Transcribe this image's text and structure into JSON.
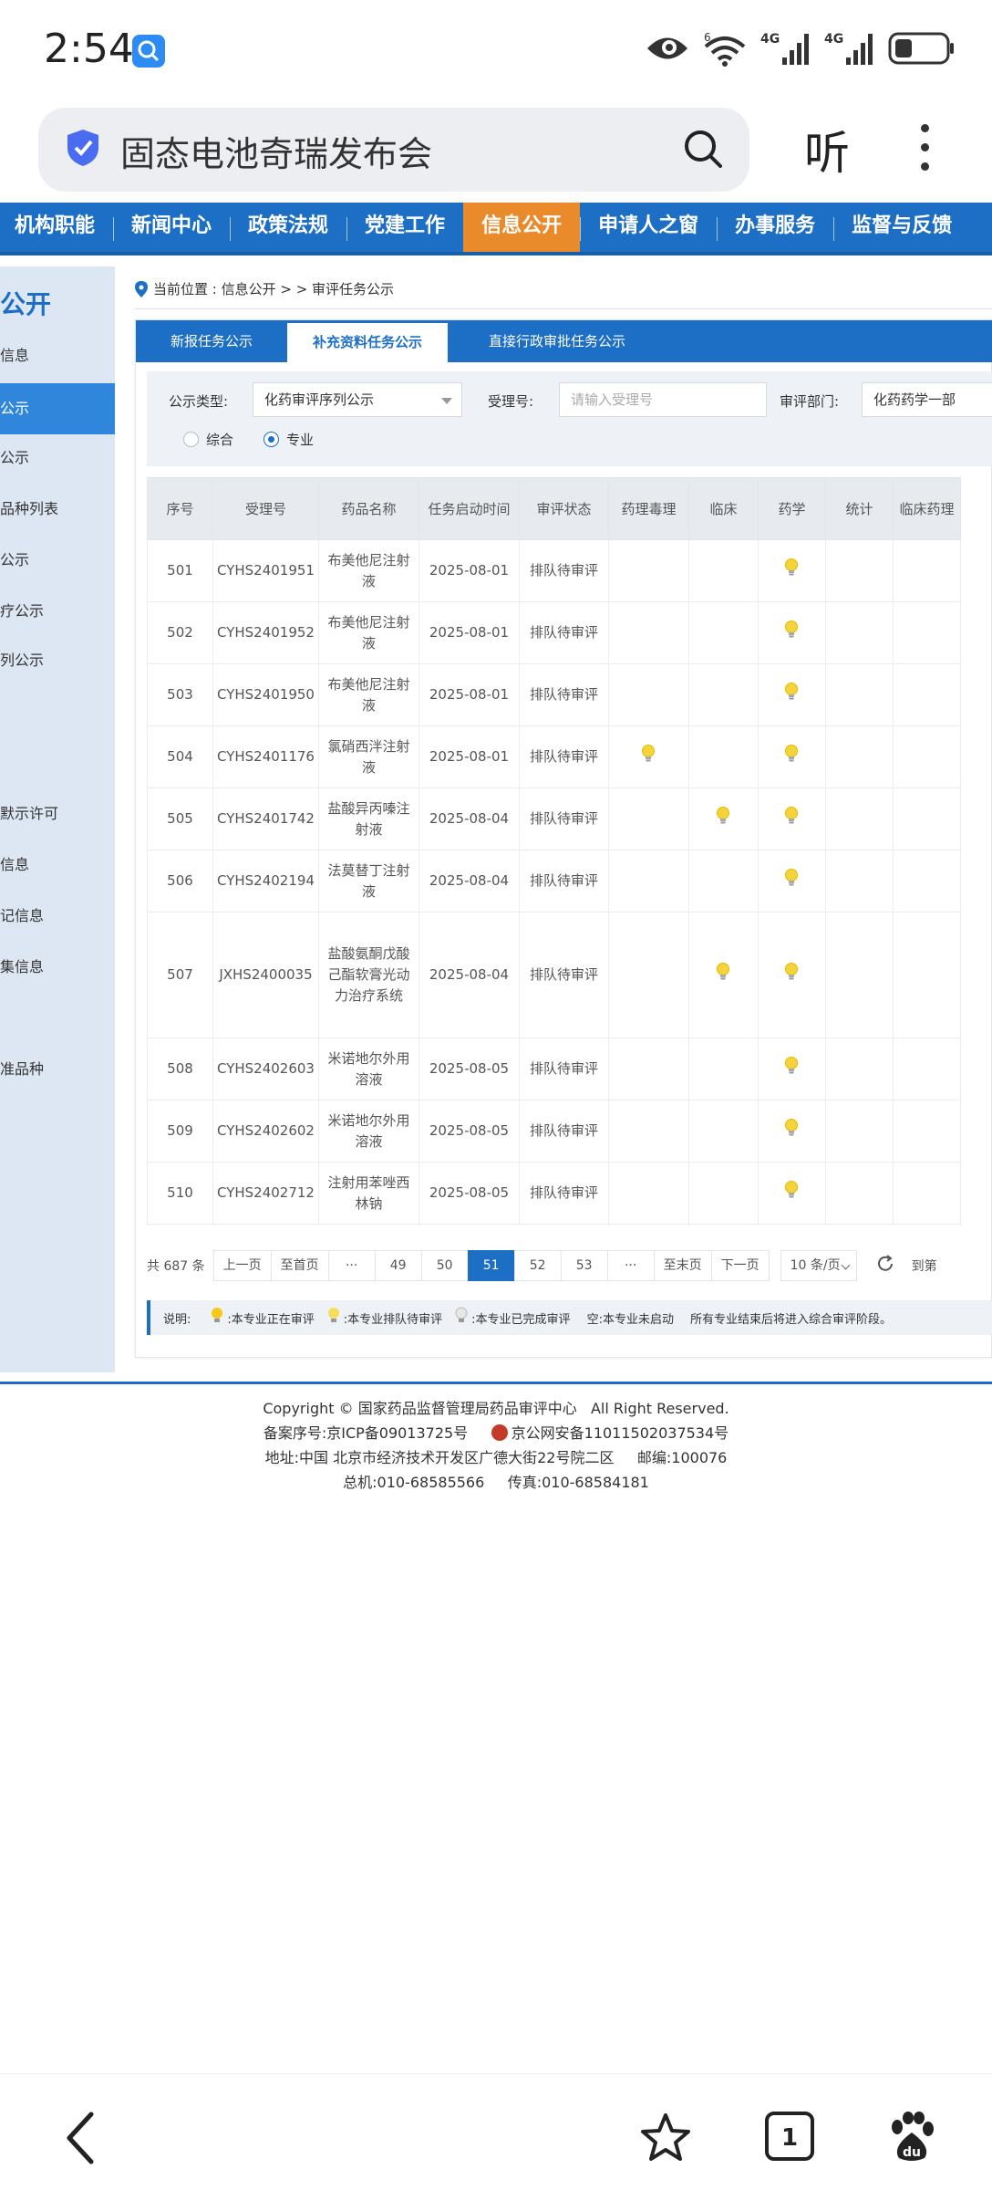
{
  "status_bar": {
    "time": "2:54",
    "icons": [
      "search-app-icon",
      "eye-icon",
      "wifi-6-icon",
      "signal-4g-icon",
      "signal-4g-icon",
      "battery-icon"
    ],
    "wifi_label": "6",
    "net1": "4G",
    "net2": "4G"
  },
  "browser": {
    "search_text": "固态电池奇瑞发布会",
    "listen_label": "听"
  },
  "nav": {
    "items": [
      "机构职能",
      "新闻中心",
      "政策法规",
      "党建工作",
      "信息公开",
      "申请人之窗",
      "办事服务",
      "监督与反馈"
    ],
    "active_index": 4
  },
  "sidebar": {
    "title": "公开",
    "items": [
      "信息",
      "公示",
      "公示",
      "品种列表",
      "公示",
      "疗公示",
      "列公示",
      "默示许可",
      "信息",
      "记信息",
      "集信息",
      "准品种"
    ],
    "active_index": 1
  },
  "breadcrumb": {
    "text": "当前位置 : 信息公开 > > 审评任务公示"
  },
  "tabs": [
    "新报任务公示",
    "补充资料任务公示",
    "直接行政审批任务公示"
  ],
  "tabs_active_index": 1,
  "filters": {
    "type_label": "公示类型:",
    "type_value": "化药审评序列公示",
    "accept_label": "受理号:",
    "accept_placeholder": "请输入受理号",
    "dept_label": "审评部门:",
    "dept_value": "化药药学一部",
    "radio1": "综合",
    "radio2": "专业",
    "radio_selected": "专业"
  },
  "table": {
    "headers": [
      "序号",
      "受理号",
      "药品名称",
      "任务启动时间",
      "审评状态",
      "药理毒理",
      "临床",
      "药学",
      "统计",
      "临床药理"
    ],
    "rows": [
      {
        "no": "501",
        "acc": "CYHS2401951",
        "name": "布美他尼注射液",
        "date": "2025-08-01",
        "status": "排队待审评",
        "tox": false,
        "clin": false,
        "pharm": true
      },
      {
        "no": "502",
        "acc": "CYHS2401952",
        "name": "布美他尼注射液",
        "date": "2025-08-01",
        "status": "排队待审评",
        "tox": false,
        "clin": false,
        "pharm": true
      },
      {
        "no": "503",
        "acc": "CYHS2401950",
        "name": "布美他尼注射液",
        "date": "2025-08-01",
        "status": "排队待审评",
        "tox": false,
        "clin": false,
        "pharm": true
      },
      {
        "no": "504",
        "acc": "CYHS2401176",
        "name": "氯硝西泮注射液",
        "date": "2025-08-01",
        "status": "排队待审评",
        "tox": true,
        "clin": false,
        "pharm": true
      },
      {
        "no": "505",
        "acc": "CYHS2401742",
        "name": "盐酸异丙嗪注射液",
        "date": "2025-08-04",
        "status": "排队待审评",
        "tox": false,
        "clin": true,
        "pharm": true
      },
      {
        "no": "506",
        "acc": "CYHS2402194",
        "name": "法莫替丁注射液",
        "date": "2025-08-04",
        "status": "排队待审评",
        "tox": false,
        "clin": false,
        "pharm": true
      },
      {
        "no": "507",
        "acc": "JXHS2400035",
        "name": "盐酸氨酮戊酸己酯软膏光动力治疗系统",
        "date": "2025-08-04",
        "status": "排队待审评",
        "tox": false,
        "clin": true,
        "pharm": true
      },
      {
        "no": "508",
        "acc": "CYHS2402603",
        "name": "米诺地尔外用溶液",
        "date": "2025-08-05",
        "status": "排队待审评",
        "tox": false,
        "clin": false,
        "pharm": true
      },
      {
        "no": "509",
        "acc": "CYHS2402602",
        "name": "米诺地尔外用溶液",
        "date": "2025-08-05",
        "status": "排队待审评",
        "tox": false,
        "clin": false,
        "pharm": true
      },
      {
        "no": "510",
        "acc": "CYHS2402712",
        "name": "注射用苯唑西林钠",
        "date": "2025-08-05",
        "status": "排队待审评",
        "tox": false,
        "clin": false,
        "pharm": true
      }
    ]
  },
  "pager": {
    "total": "共 687 条",
    "prev": "上一页",
    "first": "至首页",
    "ellipsis": "···",
    "pages": [
      "49",
      "50",
      "51",
      "52",
      "53"
    ],
    "current": "51",
    "last": "至末页",
    "next": "下一页",
    "page_size": "10 条/页",
    "goto": "到第"
  },
  "legend": {
    "title": "说明:",
    "item1": ":本专业正在审评",
    "item2": ":本专业排队待审评",
    "item3": ":本专业已完成审评",
    "item4": "空:本专业未启动",
    "item5": "所有专业结束后将进入综合审评阶段。"
  },
  "footer": {
    "line1": "Copyright © 国家药品监督管理局药品审评中心   All Right Reserved.",
    "line2a": "备案序号:京ICP备09013725号",
    "line2b": "京公网安备11011502037534号",
    "line3": "地址:中国 北京市经济技术开发区广德大街22号院二区     邮编:100076",
    "line4": "总机:010-68585566     传真:010-68584181"
  },
  "bottom_bar": {
    "tab_count": "1",
    "icons": [
      "back-icon",
      "star-icon",
      "tabs-icon",
      "baidu-paw-icon"
    ]
  },
  "colors": {
    "nav_blue": "#1d6ec5",
    "nav_active_orange": "#e98b2a",
    "bulb_yellow": "#f5d33a"
  }
}
